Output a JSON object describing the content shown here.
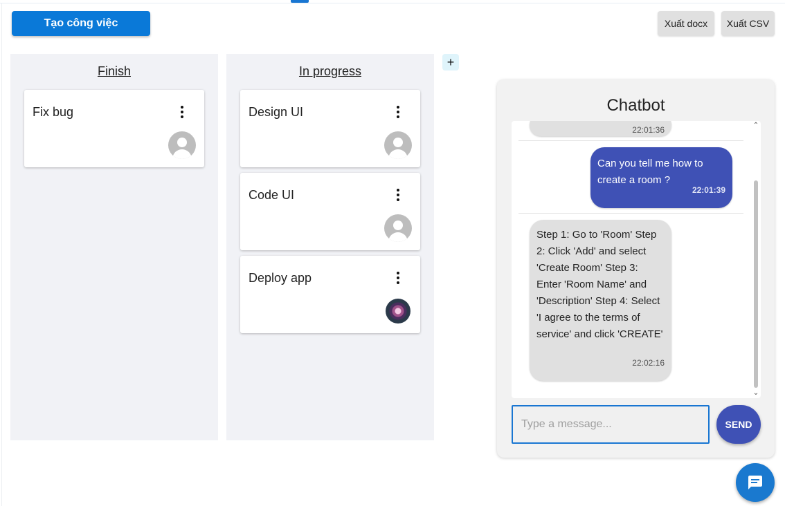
{
  "toolbar": {
    "create_label": "Tạo công việc",
    "export_docx_label": "Xuất docx",
    "export_csv_label": "Xuất CSV"
  },
  "columns": [
    {
      "title": "Finish",
      "cards": [
        {
          "title": "Fix bug",
          "avatar": "default-user"
        }
      ]
    },
    {
      "title": "In progress",
      "cards": [
        {
          "title": "Design UI",
          "avatar": "default-user"
        },
        {
          "title": "Code UI",
          "avatar": "default-user"
        },
        {
          "title": "Deploy app",
          "avatar": "flower-photo"
        }
      ]
    }
  ],
  "add_column_label": "+",
  "chat": {
    "title": "Chatbot",
    "previous_time": "22:01:36",
    "messages": [
      {
        "sender": "user",
        "text": "Can you tell me how to create a room ?",
        "time": "22:01:39"
      },
      {
        "sender": "bot",
        "text": "Step 1: Go to 'Room' Step 2: Click 'Add' and select 'Create Room' Step 3: Enter 'Room Name' and 'Description' Step 4: Select 'I agree to the terms of service' and click 'CREATE'",
        "time": "22:02:16"
      }
    ],
    "input_placeholder": "Type a message...",
    "input_value": "",
    "send_label": "SEND"
  },
  "colors": {
    "primary": "#0a79d8",
    "chat_user_bubble": "#3f51b5",
    "chat_bot_bubble": "#e0e0e0",
    "column_bg": "#f1f2f6",
    "fab": "#1a79cf"
  },
  "icons": {
    "card_menu": "more-vertical-icon",
    "avatar_default": "user-avatar-icon",
    "fab": "chat-bubble-icon"
  }
}
